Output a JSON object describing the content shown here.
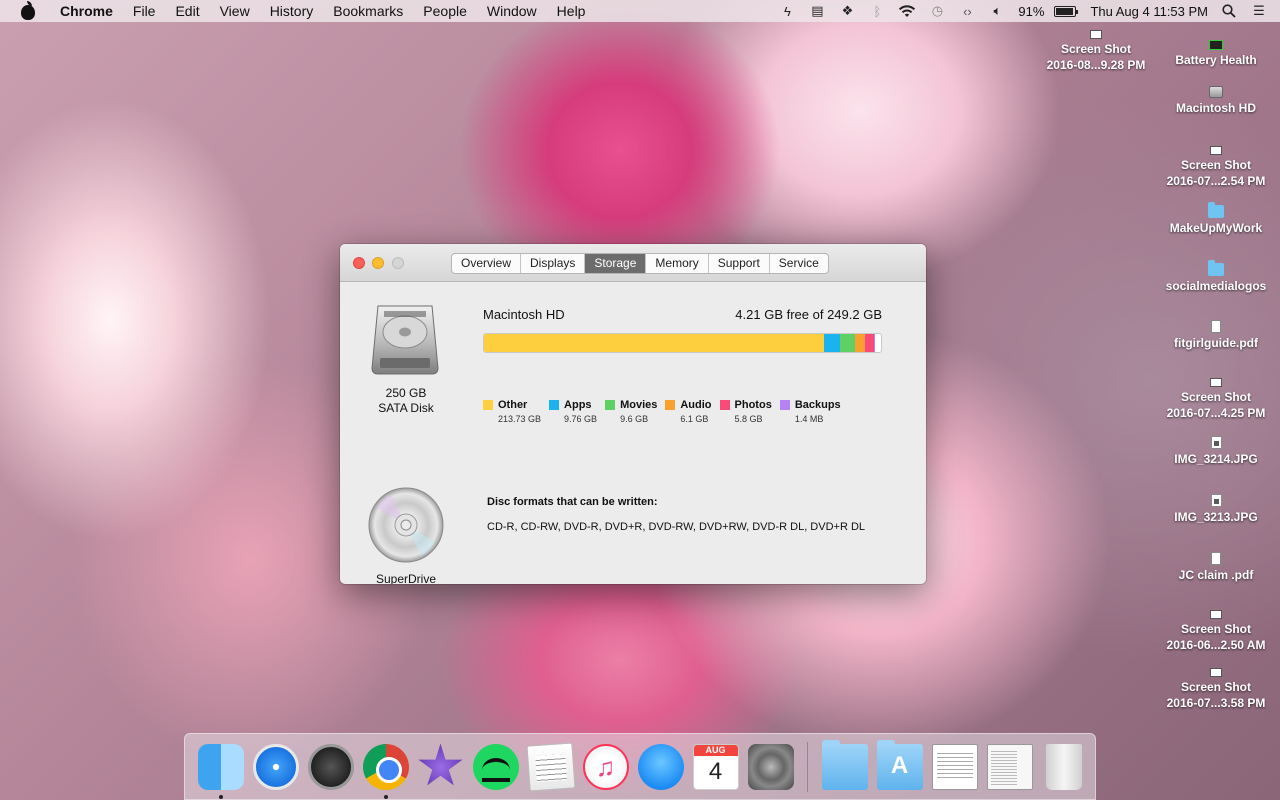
{
  "menubar": {
    "app_name": "Chrome",
    "menus": [
      "File",
      "Edit",
      "View",
      "History",
      "Bookmarks",
      "People",
      "Window",
      "Help"
    ],
    "battery_percent": "91%",
    "battery_level": 0.91,
    "clock": "Thu Aug 4  11:53 PM"
  },
  "desktop_icons": [
    {
      "label_line1": "Screen Shot",
      "label_line2": "2016-08...9.28 PM",
      "kind": "screenshot"
    },
    {
      "label_line1": "Battery Health",
      "label_line2": "",
      "kind": "battery-app"
    },
    {
      "label_line1": "Macintosh HD",
      "label_line2": "",
      "kind": "hard-drive"
    },
    {
      "label_line1": "Screen Shot",
      "label_line2": "2016-07...2.54 PM",
      "kind": "screenshot"
    },
    {
      "label_line1": "MakeUpMyWork",
      "label_line2": "",
      "kind": "folder"
    },
    {
      "label_line1": "socialmedialogos",
      "label_line2": "",
      "kind": "folder"
    },
    {
      "label_line1": "fitgirlguide.pdf",
      "label_line2": "",
      "kind": "pdf"
    },
    {
      "label_line1": "Screen Shot",
      "label_line2": "2016-07...4.25 PM",
      "kind": "screenshot"
    },
    {
      "label_line1": "IMG_3214.JPG",
      "label_line2": "",
      "kind": "jpg"
    },
    {
      "label_line1": "IMG_3213.JPG",
      "label_line2": "",
      "kind": "jpg"
    },
    {
      "label_line1": "JC claim .pdf",
      "label_line2": "",
      "kind": "pdf"
    },
    {
      "label_line1": "Screen Shot",
      "label_line2": "2016-06...2.50 AM",
      "kind": "screenshot"
    },
    {
      "label_line1": "Screen Shot",
      "label_line2": "2016-07...3.58 PM",
      "kind": "screenshot"
    }
  ],
  "window": {
    "tabs": [
      "Overview",
      "Displays",
      "Storage",
      "Memory",
      "Support",
      "Service"
    ],
    "active_tab": "Storage",
    "disk": {
      "name": "Macintosh HD",
      "free_text": "4.21 GB free of 249.2 GB",
      "caption_line1": "250 GB",
      "caption_line2": "SATA Disk",
      "categories": [
        {
          "label": "Other",
          "size": "213.73 GB",
          "gb": 213.73,
          "color": "#fdcf3e"
        },
        {
          "label": "Apps",
          "size": "9.76 GB",
          "gb": 9.76,
          "color": "#1bb3ef"
        },
        {
          "label": "Movies",
          "size": "9.6 GB",
          "gb": 9.6,
          "color": "#5dd163"
        },
        {
          "label": "Audio",
          "size": "6.1 GB",
          "gb": 6.1,
          "color": "#f9a12e"
        },
        {
          "label": "Photos",
          "size": "5.8 GB",
          "gb": 5.8,
          "color": "#f94a78"
        },
        {
          "label": "Backups",
          "size": "1.4 MB",
          "gb": 0.0014,
          "color": "#b583f3"
        }
      ],
      "total_gb": 249.2
    },
    "drive": {
      "caption": "SuperDrive",
      "formats_title": "Disc formats that can be written:",
      "formats": "CD-R, CD-RW, DVD-R, DVD+R, DVD-RW, DVD+RW, DVD-R DL, DVD+R DL"
    }
  },
  "dock": {
    "apps": [
      {
        "name": "Finder",
        "running": true
      },
      {
        "name": "Safari",
        "running": false
      },
      {
        "name": "Dashboard",
        "running": false
      },
      {
        "name": "Google Chrome",
        "running": true
      },
      {
        "name": "iMovie",
        "running": false
      },
      {
        "name": "Spotify",
        "running": false
      },
      {
        "name": "TextEdit",
        "running": false
      },
      {
        "name": "iTunes",
        "running": false
      },
      {
        "name": "Messages",
        "running": false
      },
      {
        "name": "Calendar",
        "running": false
      },
      {
        "name": "System Preferences",
        "running": false
      }
    ],
    "calendar_month": "AUG",
    "calendar_day": "4"
  }
}
